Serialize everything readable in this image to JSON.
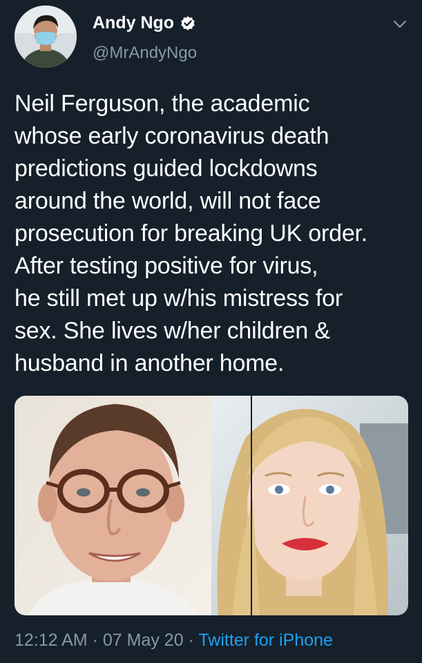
{
  "author": {
    "display_name": "Andy Ngo",
    "handle": "@MrAndyNgo",
    "verified": true
  },
  "tweet": {
    "lines": [
      "Neil Ferguson, the academic",
      "whose early coronavirus death",
      "predictions guided lockdowns",
      "around the world, will not face",
      "prosecution for breaking UK order.",
      "After testing positive for virus,",
      "he still met up w/his mistress for",
      "sex. She lives w/her children &",
      "husband in another home."
    ]
  },
  "meta": {
    "time": "12:12 AM",
    "separator": " · ",
    "date": "07 May 20",
    "source": "Twitter for iPhone"
  },
  "colors": {
    "background": "#15202b",
    "text": "#ffffff",
    "secondary": "#8899a6",
    "link": "#1da1f2"
  },
  "icons": {
    "verified": "verified-badge-icon",
    "more": "chevron-down-icon"
  }
}
